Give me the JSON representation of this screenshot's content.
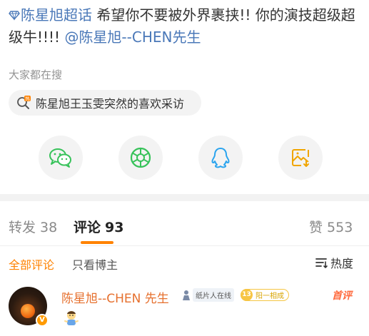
{
  "post": {
    "topic": "陈星旭超话",
    "text_line": " 希望你不要被外界裹挟!! 你的演技超级超级牛!!!! ",
    "mention": "@陈星旭--CHEN先生"
  },
  "search": {
    "section_title": "大家都在搜",
    "query": "陈星旭王玉雯突然的喜欢采访"
  },
  "share": {
    "icons": [
      "wechat-icon",
      "moments-icon",
      "qq-icon",
      "save-image-icon"
    ],
    "colors": {
      "wechat": "#37c25a",
      "moments": "#37c25a",
      "qq": "#2ba4ee",
      "save": "#f0a500"
    }
  },
  "tabs": {
    "repost_label": "转发",
    "repost_count": "38",
    "comment_label": "评论",
    "comment_count": "93",
    "like_label": "赞",
    "like_count": "553"
  },
  "filters": {
    "all_label": "全部评论",
    "author_only_label": "只看博主",
    "sort_label": "热度"
  },
  "comment": {
    "author": "陈星旭--CHEN 先生",
    "fan_badge": "纸片人在线",
    "level_num": "13",
    "level_text": "阳一相成",
    "first_tag": "首评",
    "avatar_badge": "V"
  },
  "colors": {
    "accent_orange": "#ff8200",
    "link_blue": "#4a78b8"
  }
}
